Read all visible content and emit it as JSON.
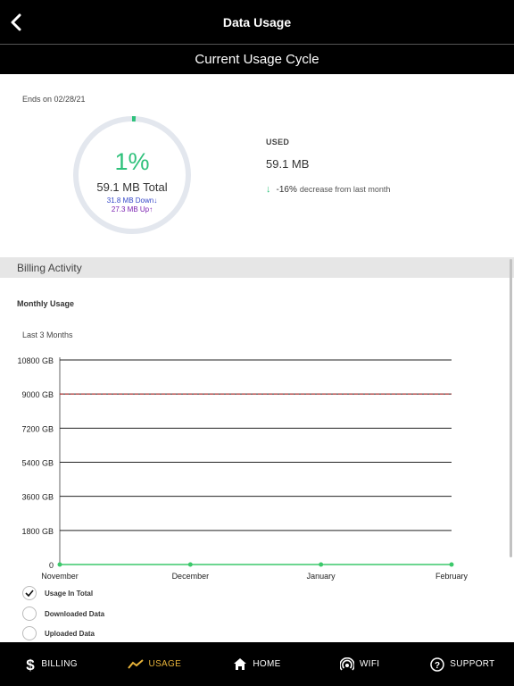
{
  "header": {
    "title": "Data Usage",
    "back_icon": "chevron-left-icon"
  },
  "cycle": {
    "title": "Current Usage Cycle",
    "ends": "Ends on 02/28/21",
    "percent": "1%",
    "percent_fraction": 0.01,
    "total": "59.1 MB Total",
    "down": "31.8 MB Down",
    "up": "27.3 MB Up",
    "used_label": "USED",
    "used_value": "59.1 MB",
    "change_pct": "-16%",
    "change_text": "decrease from last month",
    "colors": {
      "percent": "#2ec17b",
      "down": "#3547c8",
      "up": "#7a1fb0"
    }
  },
  "billing": {
    "section_title": "Billing Activity",
    "monthly_label": "Monthly Usage",
    "range_label": "Last 3 Months"
  },
  "chart_data": {
    "type": "line",
    "categories": [
      "November",
      "December",
      "January",
      "February"
    ],
    "series": [
      {
        "name": "Usage In Total",
        "values": [
          0,
          0,
          0,
          0
        ],
        "color": "#3cc96b"
      }
    ],
    "yticks": [
      "10800 GB",
      "9000 GB",
      "7200 GB",
      "5400 GB",
      "3600 GB",
      "1800 GB",
      "0"
    ],
    "ytick_values": [
      10800,
      9000,
      7200,
      5400,
      3600,
      1800,
      0
    ],
    "ylim": [
      0,
      10800
    ],
    "limit_line": {
      "value": 9000,
      "color": "#c42b2b",
      "style": "dashed"
    },
    "grid": true
  },
  "legend": [
    {
      "label": "Usage In Total",
      "checked": true
    },
    {
      "label": "Downloaded Data",
      "checked": false
    },
    {
      "label": "Uploaded Data",
      "checked": false
    }
  ],
  "tabs": [
    {
      "label": "BILLING",
      "icon": "dollar-icon",
      "active": false
    },
    {
      "label": "USAGE",
      "icon": "trend-icon",
      "active": true
    },
    {
      "label": "HOME",
      "icon": "home-icon",
      "active": false
    },
    {
      "label": "WIFI",
      "icon": "wifi-icon",
      "active": false
    },
    {
      "label": "SUPPORT",
      "icon": "help-icon",
      "active": false
    }
  ],
  "tab_active_color": "#e9b43a"
}
